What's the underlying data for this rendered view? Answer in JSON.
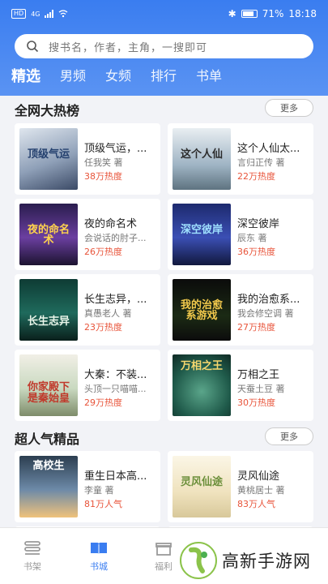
{
  "statusbar": {
    "signal_label": "HD",
    "net_label": "4G",
    "battery_text": "71%",
    "time": "18:18"
  },
  "search": {
    "placeholder": "搜书名，作者，主角，一搜即可"
  },
  "tabs": [
    {
      "label": "精选",
      "active": true
    },
    {
      "label": "男频",
      "active": false
    },
    {
      "label": "女频",
      "active": false
    },
    {
      "label": "排行",
      "active": false
    },
    {
      "label": "书单",
      "active": false
    }
  ],
  "sections": {
    "hot": {
      "title": "全网大热榜",
      "more": "更多"
    },
    "popular": {
      "title": "超人气精品",
      "more": "更多"
    }
  },
  "hot_books": [
    {
      "title": "顶级气运，...",
      "author": "任我笑 著",
      "heat": "38万热度",
      "cover_text": "顶级气运"
    },
    {
      "title": "这个人仙太...",
      "author": "言归正传 著",
      "heat": "22万热度",
      "cover_text": "这个人仙"
    },
    {
      "title": "夜的命名术",
      "author": "会说话的肘子...",
      "heat": "26万热度",
      "cover_text": "夜的命名术"
    },
    {
      "title": "深空彼岸",
      "author": "辰东 著",
      "heat": "36万热度",
      "cover_text": "深空彼岸"
    },
    {
      "title": "长生志异，...",
      "author": "真愚老人 著",
      "heat": "23万热度",
      "cover_text": "长生志异"
    },
    {
      "title": "我的治愈系...",
      "author": "我会修空调 著",
      "heat": "27万热度",
      "cover_text": "我的治愈系游戏"
    },
    {
      "title": "大秦：不装...",
      "author": "头顶一只喵喵...",
      "heat": "29万热度",
      "cover_text": "你家殿下是秦始皇"
    },
    {
      "title": "万相之王",
      "author": "天蚕土豆 著",
      "heat": "30万热度",
      "cover_text": "万相之王"
    }
  ],
  "popular_books": [
    {
      "title": "重生日本高...",
      "author": "李童 著",
      "heat": "81万人气",
      "cover_text": "高校生"
    },
    {
      "title": "灵风仙途",
      "author": "黄桃居士 著",
      "heat": "83万人气",
      "cover_text": "灵风仙途"
    }
  ],
  "bottom_nav": [
    {
      "label": "书架",
      "icon": "bookshelf-icon",
      "active": false
    },
    {
      "label": "书城",
      "icon": "book-open-icon",
      "active": true
    },
    {
      "label": "福利",
      "icon": "gift-icon",
      "active": false
    }
  ],
  "watermark": {
    "text": "高新手游网"
  },
  "colors": {
    "primary": "#3a7df0",
    "heat": "#e8543a"
  }
}
